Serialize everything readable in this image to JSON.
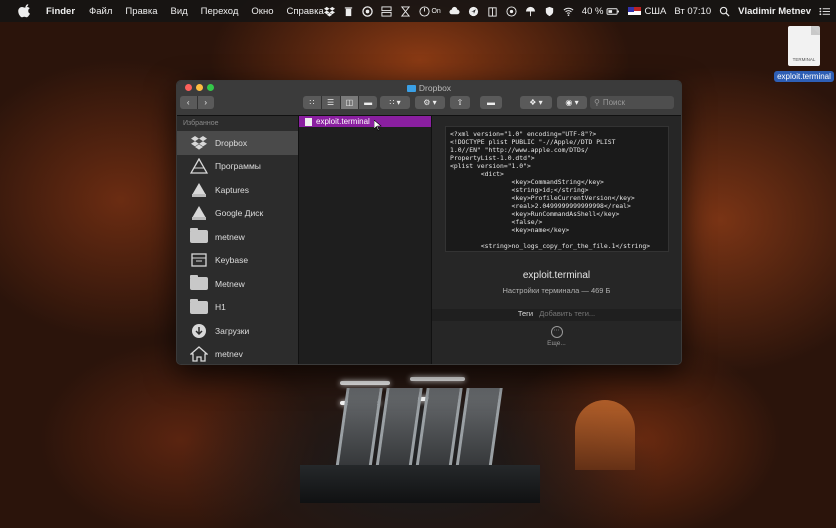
{
  "menubar": {
    "app": "Finder",
    "items": [
      "Файл",
      "Правка",
      "Вид",
      "Переход",
      "Окно",
      "Справка"
    ],
    "status": {
      "on_label": "On",
      "battery": "40 %",
      "input_source": "США",
      "clock": "Вт 07:10",
      "user": "Vladimir Metnev"
    }
  },
  "desktop_file": {
    "doc_text": "TERMINAL",
    "name": "exploit.terminal"
  },
  "window": {
    "title": "Dropbox",
    "search_placeholder": "Поиск",
    "sidebar": {
      "header": "Избранное",
      "items": [
        {
          "label": "Dropbox",
          "icon": "dropbox-icon"
        },
        {
          "label": "Программы",
          "icon": "applications-icon"
        },
        {
          "label": "Kaptures",
          "icon": "drive-icon"
        },
        {
          "label": "Google Диск",
          "icon": "drive-icon"
        },
        {
          "label": "metnew",
          "icon": "folder-icon"
        },
        {
          "label": "Keybase",
          "icon": "keybase-icon"
        },
        {
          "label": "Metnew",
          "icon": "folder-icon"
        },
        {
          "label": "H1",
          "icon": "folder-icon"
        },
        {
          "label": "Загрузки",
          "icon": "downloads-icon"
        },
        {
          "label": "metnev",
          "icon": "home-icon"
        }
      ]
    },
    "column": {
      "selected_file": "exploit.terminal",
      "selected_color": "#8a1fa0"
    },
    "preview": {
      "xml": "<?xml version=\"1.0\" encoding=\"UTF-8\"?>\n<!DOCTYPE plist PUBLIC \"-//Apple//DTD PLIST\n1.0//EN\" \"http://www.apple.com/DTDs/\nPropertyList-1.0.dtd\">\n<plist version=\"1.0\">\n        <dict>\n                <key>CommandString</key>\n                <string>id;</string>\n                <key>ProfileCurrentVersion</key>\n                <real>2.0499999999999998</real>\n                <key>RunCommandAsShell</key>\n                <false/>\n                <key>name</key>\n\n        <string>no_logs_copy_for_the_file.1</string>",
      "filename": "exploit.terminal",
      "info": "Настройки терминала — 469 Б",
      "tags_label": "Теги",
      "tags_placeholder": "Добавить теги...",
      "more_label": "Еще..."
    }
  }
}
